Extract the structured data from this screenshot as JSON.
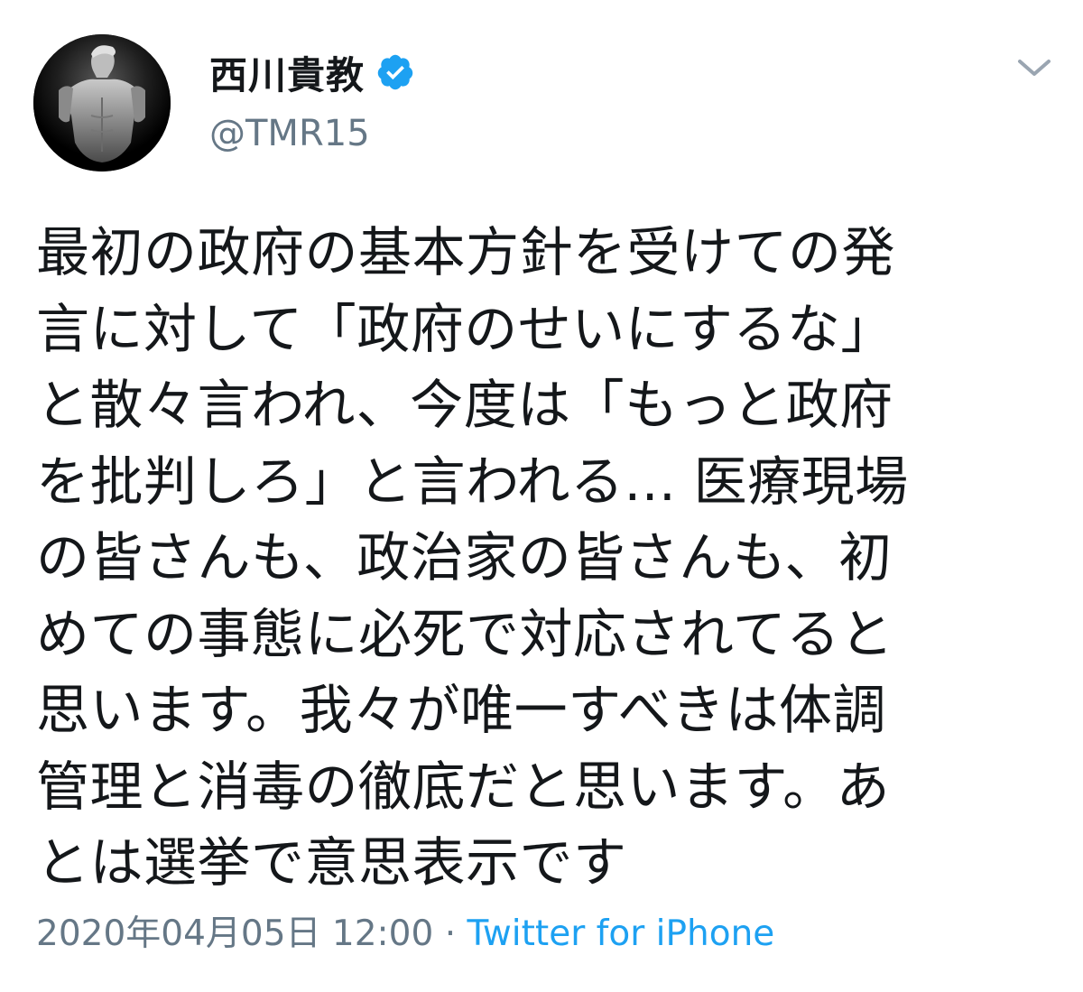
{
  "author": {
    "display_name": "西川貴教",
    "handle": "@TMR15",
    "verified": true
  },
  "tweet": {
    "text": "最初の政府の基本方針を受けての発\n言に対して「政府のせいにするな」\nと散々言われ、今度は「もっと政府\nを批判しろ」と言われる... 医療現場\nの皆さんも、政治家の皆さんも、初\nめての事態に必死で対応されてると\n思います。我々が唯一すべきは体調\n管理と消毒の徹底だと思います。あ\nとは選挙で意思表示です"
  },
  "meta": {
    "timestamp": "2020年04月05日 12:00",
    "separator": "·",
    "source": "Twitter for iPhone"
  },
  "icons": {
    "verified": "verified-badge-icon",
    "caret": "chevron-down-icon",
    "avatar": "profile-photo"
  },
  "colors": {
    "accent": "#1da1f2",
    "secondary_text": "#657786",
    "primary_text": "#14171a"
  }
}
